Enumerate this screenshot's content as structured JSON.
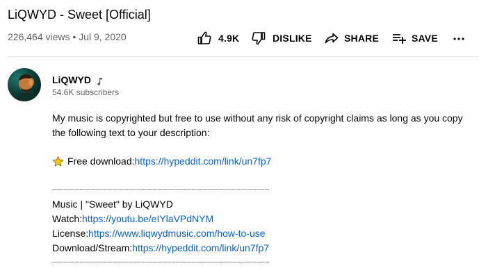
{
  "video": {
    "title": "LiQWYD - Sweet [Official]",
    "views": "226,464 views",
    "separator": "•",
    "date": "Jul 9, 2020"
  },
  "actions": {
    "like_count": "4.9K",
    "dislike_label": "DISLIKE",
    "share_label": "SHARE",
    "save_label": "SAVE",
    "more_icon": "more-vert-icon"
  },
  "channel": {
    "name": "LiQWYD",
    "verified_icon": "music-note-icon",
    "subscribers": "54.6K subscribers"
  },
  "description": {
    "intro_line1": "My music is copyrighted but free to use without any risk of copyright claims as long as you copy",
    "intro_line2": "the following text to your description:",
    "free_download_label": "Free download: ",
    "free_download_link": "https://hypeddit.com/link/un7fp7",
    "rule": "--------------------------------------------------------------------------------------------------------------------------------------",
    "music_line": "Music | \"Sweet\" by LiQWYD",
    "watch_label": "Watch: ",
    "watch_link": "https://youtu.be/eIYlaVPdNYM",
    "license_label": "License: ",
    "license_link": "https://www.liqwydmusic.com/how-to-use",
    "download_label": "Download/Stream: ",
    "download_link": "https://hypeddit.com/link/un7fp7"
  },
  "colors": {
    "link": "#065fd4",
    "secondary_text": "#606060",
    "primary_text": "#030303"
  }
}
